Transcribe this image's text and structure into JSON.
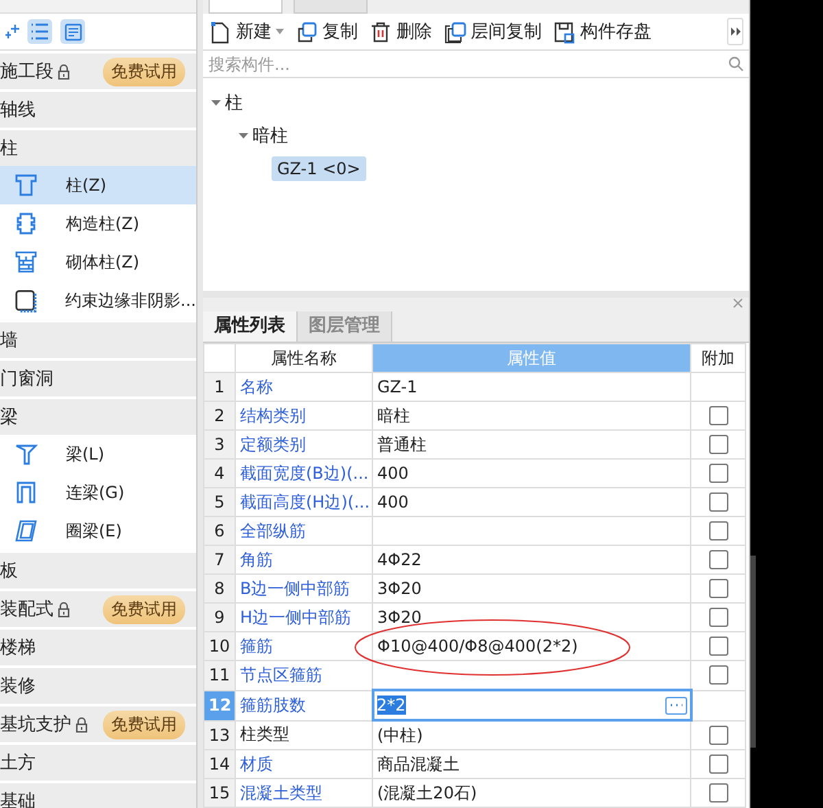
{
  "nav": {
    "categories": [
      {
        "label": "施工段",
        "locked": true,
        "badge": "免费试用"
      },
      {
        "label": "轴线",
        "locked": false
      },
      {
        "label": "柱",
        "locked": false,
        "children": [
          {
            "label": "柱(Z)",
            "kind": "column",
            "selected": true
          },
          {
            "label": "构造柱(Z)",
            "kind": "structural-column",
            "selected": false
          },
          {
            "label": "砌体柱(Z)",
            "kind": "masonry-column",
            "selected": false
          },
          {
            "label": "约束边缘非阴影...",
            "kind": "edge",
            "selected": false
          }
        ]
      },
      {
        "label": "墙",
        "locked": false
      },
      {
        "label": "门窗洞",
        "locked": false
      },
      {
        "label": "梁",
        "locked": false,
        "children": [
          {
            "label": "梁(L)",
            "kind": "beam",
            "selected": false
          },
          {
            "label": "连梁(G)",
            "kind": "link-beam",
            "selected": false
          },
          {
            "label": "圈梁(E)",
            "kind": "ring-beam",
            "selected": false
          }
        ]
      },
      {
        "label": "板",
        "locked": false
      },
      {
        "label": "装配式",
        "locked": true,
        "badge": "免费试用"
      },
      {
        "label": "楼梯",
        "locked": false
      },
      {
        "label": "装修",
        "locked": false
      },
      {
        "label": "基坑支护",
        "locked": true,
        "badge": "免费试用"
      },
      {
        "label": "土方",
        "locked": false
      },
      {
        "label": "基础",
        "locked": false
      }
    ]
  },
  "component_panel": {
    "toolbar": [
      {
        "label": "新建",
        "kind": "new"
      },
      {
        "label": "复制",
        "kind": "copy"
      },
      {
        "label": "删除",
        "kind": "delete"
      },
      {
        "label": "层间复制",
        "kind": "floor-copy"
      },
      {
        "label": "构件存盘",
        "kind": "save"
      }
    ],
    "search": {
      "placeholder": "搜索构件..."
    },
    "tree": [
      {
        "label": "柱",
        "expanded": true,
        "children": [
          {
            "label": "暗柱",
            "expanded": true,
            "children": [
              {
                "label": "GZ-1 <0>",
                "selected": true
              }
            ]
          }
        ]
      }
    ]
  },
  "property_panel": {
    "tabs": [
      {
        "label": "属性列表",
        "selected": true
      },
      {
        "label": "图层管理",
        "selected": false
      }
    ],
    "columns": [
      "属性名称",
      "属性值",
      "附加"
    ],
    "rows": [
      {
        "index": "1",
        "name": "名称",
        "value": "GZ-1",
        "public": true,
        "selected": false
      },
      {
        "index": "2",
        "name": "结构类别",
        "value": "暗柱",
        "public": true,
        "selected": false,
        "checked": false
      },
      {
        "index": "3",
        "name": "定额类别",
        "value": "普通柱",
        "public": true,
        "selected": false,
        "checked": false
      },
      {
        "index": "4",
        "name": "截面宽度(B边)(...",
        "value": "400",
        "public": true,
        "selected": false,
        "checked": false
      },
      {
        "index": "5",
        "name": "截面高度(H边)(...",
        "value": "400",
        "public": true,
        "selected": false,
        "checked": false
      },
      {
        "index": "6",
        "name": "全部纵筋",
        "public": true,
        "selected": false,
        "checked": false
      },
      {
        "index": "7",
        "name": "角筋",
        "value": "4Φ22",
        "public": true,
        "selected": false,
        "checked": false
      },
      {
        "index": "8",
        "name": "B边一侧中部筋",
        "value": "3Φ20",
        "public": true,
        "selected": false,
        "checked": false
      },
      {
        "index": "9",
        "name": "H边一侧中部筋",
        "value": "3Φ20",
        "public": true,
        "selected": false,
        "checked": false
      },
      {
        "index": "10",
        "name": "箍筋",
        "value": "Φ10@400/Φ8@400(2*2)",
        "public": true,
        "selected": false,
        "checked": false,
        "circled": true
      },
      {
        "index": "11",
        "name": "节点区箍筋",
        "public": true,
        "selected": false,
        "checked": false
      },
      {
        "index": "12",
        "name": "箍筋肢数",
        "value": "2*2",
        "public": true,
        "selected": true
      },
      {
        "index": "13",
        "name": "柱类型",
        "value": "(中柱)",
        "public": false,
        "selected": false,
        "checked": false
      },
      {
        "index": "14",
        "name": "材质",
        "value": "商品混凝土",
        "public": true,
        "selected": false,
        "checked": false
      },
      {
        "index": "15",
        "name": "混凝土类型",
        "value": "(混凝土20石)",
        "public": true,
        "selected": false,
        "checked": false
      }
    ]
  }
}
